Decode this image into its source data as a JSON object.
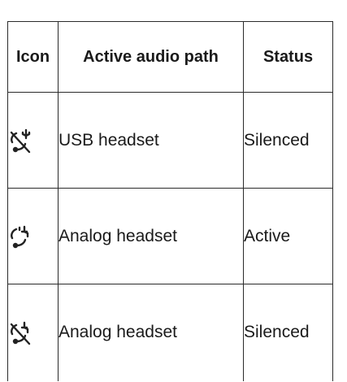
{
  "table": {
    "headers": {
      "icon": "Icon",
      "path": "Active audio path",
      "status": "Status"
    },
    "rows": [
      {
        "icon": "usb-headset-silenced-icon",
        "path": "USB headset",
        "status": "Silenced"
      },
      {
        "icon": "analog-headset-active-icon",
        "path": "Analog headset",
        "status": "Active"
      },
      {
        "icon": "analog-headset-silenced-icon",
        "path": "Analog headset",
        "status": "Silenced"
      }
    ]
  }
}
